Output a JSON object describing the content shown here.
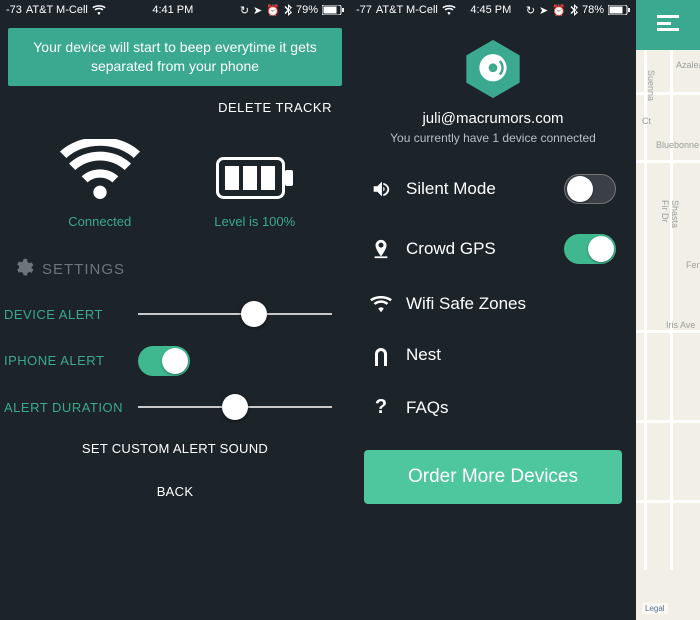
{
  "left": {
    "status": {
      "signal": "-73",
      "carrier": "AT&T M-Cell",
      "time": "4:41 PM",
      "battery_pct": "79%"
    },
    "banner": "Your device will start to beep everytime it gets separated from your phone",
    "delete": "DELETE TRACKR",
    "conn_status": "Connected",
    "battery_level": "Level is 100%",
    "settings_header": "SETTINGS",
    "device_alert": "DEVICE ALERT",
    "iphone_alert": "IPHONE ALERT",
    "alert_duration": "ALERT DURATION",
    "custom_sound": "SET CUSTOM ALERT SOUND",
    "back": "BACK",
    "slider_device_alert_pct": 60,
    "slider_alert_duration_pct": 50,
    "iphone_alert_on": true
  },
  "right": {
    "status": {
      "signal": "-77",
      "carrier": "AT&T M-Cell",
      "time": "4:45 PM",
      "battery_pct": "78%"
    },
    "email": "juli@macrumors.com",
    "subline": "You currently have 1 device connected",
    "silent_mode": {
      "label": "Silent Mode",
      "on": false
    },
    "crowd_gps": {
      "label": "Crowd GPS",
      "on": true
    },
    "wifi_safe": "Wifi Safe Zones",
    "nest": "Nest",
    "faqs": "FAQs",
    "order_btn": "Order More Devices",
    "map": {
      "legal": "Legal",
      "streets": {
        "azalea": "Azalea",
        "ct": "Ct",
        "bluebonne": "Bluebonne",
        "shasta": "Shasta Fir Dr",
        "iris": "Iris Ave",
        "ferro": "Ferro",
        "suenna": "Suenna"
      }
    }
  }
}
